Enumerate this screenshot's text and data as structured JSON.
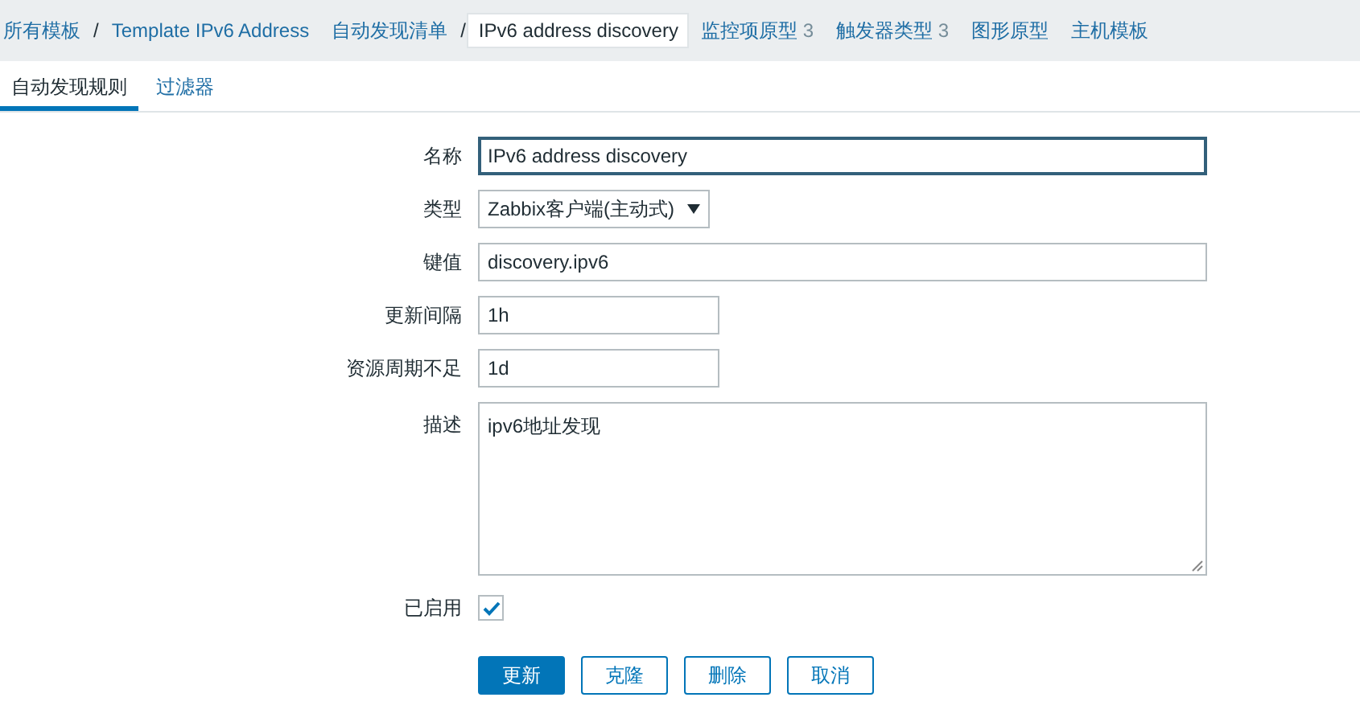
{
  "breadcrumb": [
    {
      "kind": "link",
      "label": "所有模板",
      "selected": false
    },
    {
      "kind": "separator",
      "label": "/"
    },
    {
      "kind": "link",
      "label": "Template IPv6 Address",
      "selected": false
    },
    {
      "kind": "link",
      "label": "自动发现清单",
      "selected": false
    },
    {
      "kind": "separator",
      "label": "/"
    },
    {
      "kind": "link",
      "label": "IPv6 address discovery",
      "selected": true
    },
    {
      "kind": "link",
      "label": "监控项原型",
      "count": "3",
      "selected": false
    },
    {
      "kind": "link",
      "label": "触发器类型",
      "count": "3",
      "selected": false
    },
    {
      "kind": "link",
      "label": "图形原型",
      "selected": false
    },
    {
      "kind": "link",
      "label": "主机模板",
      "selected": false
    }
  ],
  "tabs": [
    {
      "label": "自动发现规则",
      "selected": true
    },
    {
      "label": "过滤器",
      "selected": false
    }
  ],
  "form": [
    {
      "kind": "text",
      "label": "名称",
      "value": "IPv6 address discovery",
      "focused": true
    },
    {
      "kind": "select",
      "label": "类型",
      "value": "Zabbix客户端(主动式)"
    },
    {
      "kind": "text",
      "label": "键值",
      "value": "discovery.ipv6",
      "focused": false
    },
    {
      "kind": "short_text",
      "label": "更新间隔",
      "value": "1h",
      "focused": false
    },
    {
      "kind": "short_text",
      "label": "资源周期不足",
      "value": "1d",
      "focused": false
    },
    {
      "kind": "textarea",
      "label": "描述",
      "value": "ipv6地址发现"
    },
    {
      "kind": "checkbox",
      "label": "已启用",
      "checked": true
    }
  ],
  "buttons": [
    {
      "label": "更新",
      "primary": true
    },
    {
      "label": "克隆",
      "primary": false
    },
    {
      "label": "删除",
      "primary": false
    },
    {
      "label": "取消",
      "primary": false
    }
  ]
}
